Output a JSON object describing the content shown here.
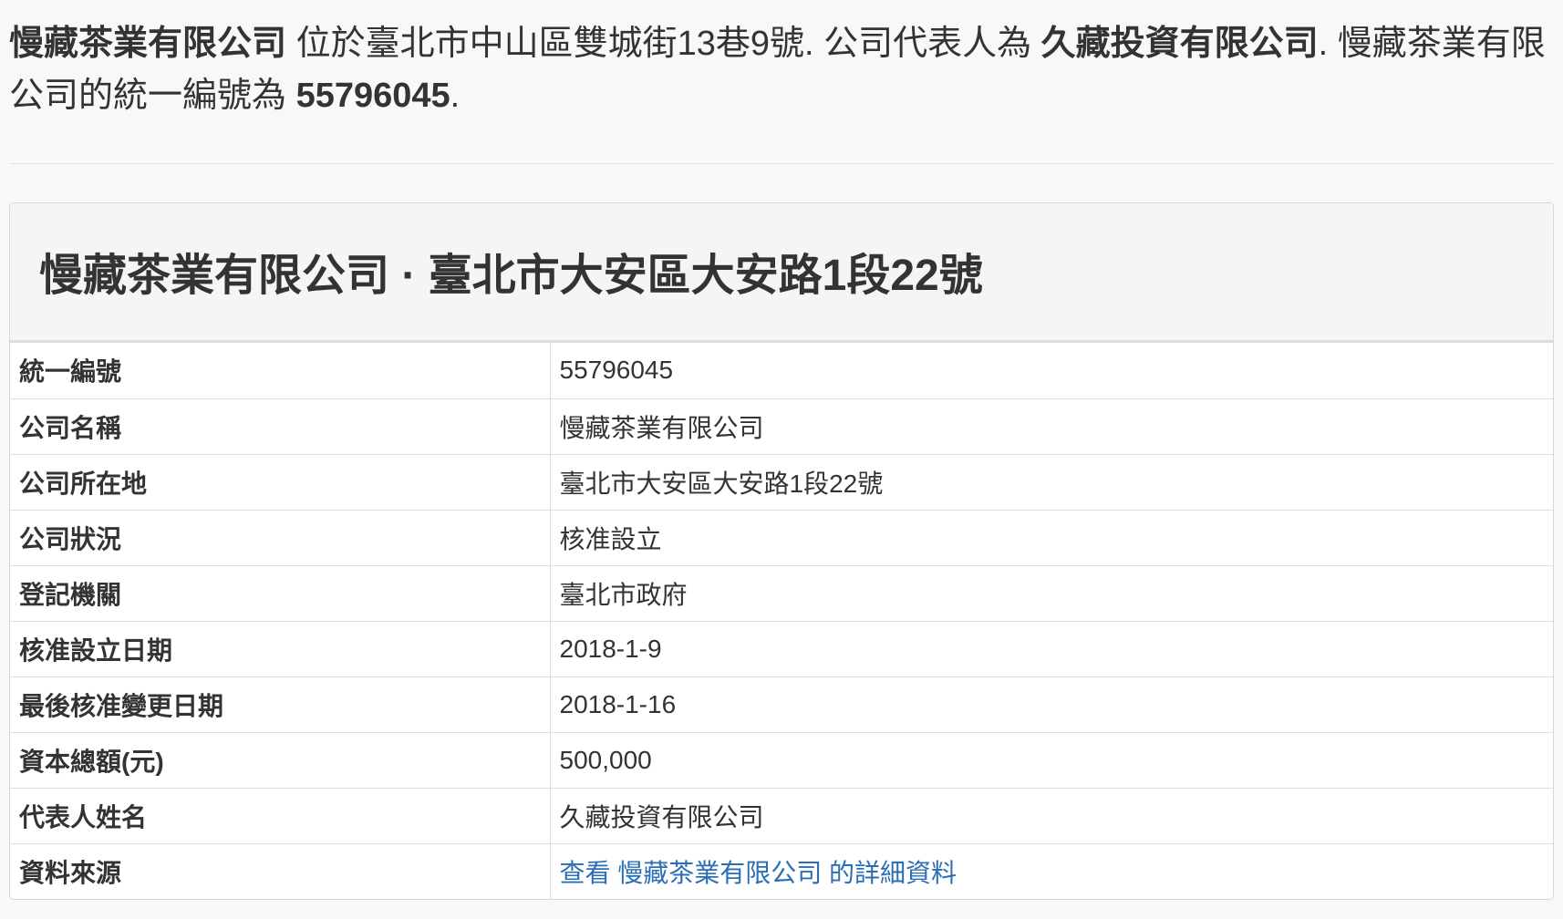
{
  "summary": {
    "company_name": "慢藏茶業有限公司",
    "located_text": " 位於臺北市中山區雙城街13巷9號. 公司代表人為 ",
    "representative": "久藏投資有限公司",
    "sep1": ". ",
    "company_name_2": "慢藏茶業有限公司",
    "tax_id_text": "的統一編號為 ",
    "tax_id": "55796045",
    "end": "."
  },
  "panel": {
    "title": "慢藏茶業有限公司 · 臺北市大安區大安路1段22號"
  },
  "table": {
    "rows": [
      {
        "label": "統一編號",
        "value": "55796045"
      },
      {
        "label": "公司名稱",
        "value": "慢藏茶業有限公司"
      },
      {
        "label": "公司所在地",
        "value": "臺北市大安區大安路1段22號"
      },
      {
        "label": "公司狀況",
        "value": "核准設立"
      },
      {
        "label": "登記機關",
        "value": "臺北市政府"
      },
      {
        "label": "核准設立日期",
        "value": "2018-1-9"
      },
      {
        "label": "最後核准變更日期",
        "value": "2018-1-16"
      },
      {
        "label": "資本總額(元)",
        "value": "500,000"
      },
      {
        "label": "代表人姓名",
        "value": "久藏投資有限公司"
      },
      {
        "label": "資料來源",
        "link_text": "查看 慢藏茶業有限公司 的詳細資料"
      }
    ]
  },
  "colors": {
    "link": "#2a6fb5",
    "background": "#f8f8f8",
    "panel_heading": "#f5f5f5"
  }
}
